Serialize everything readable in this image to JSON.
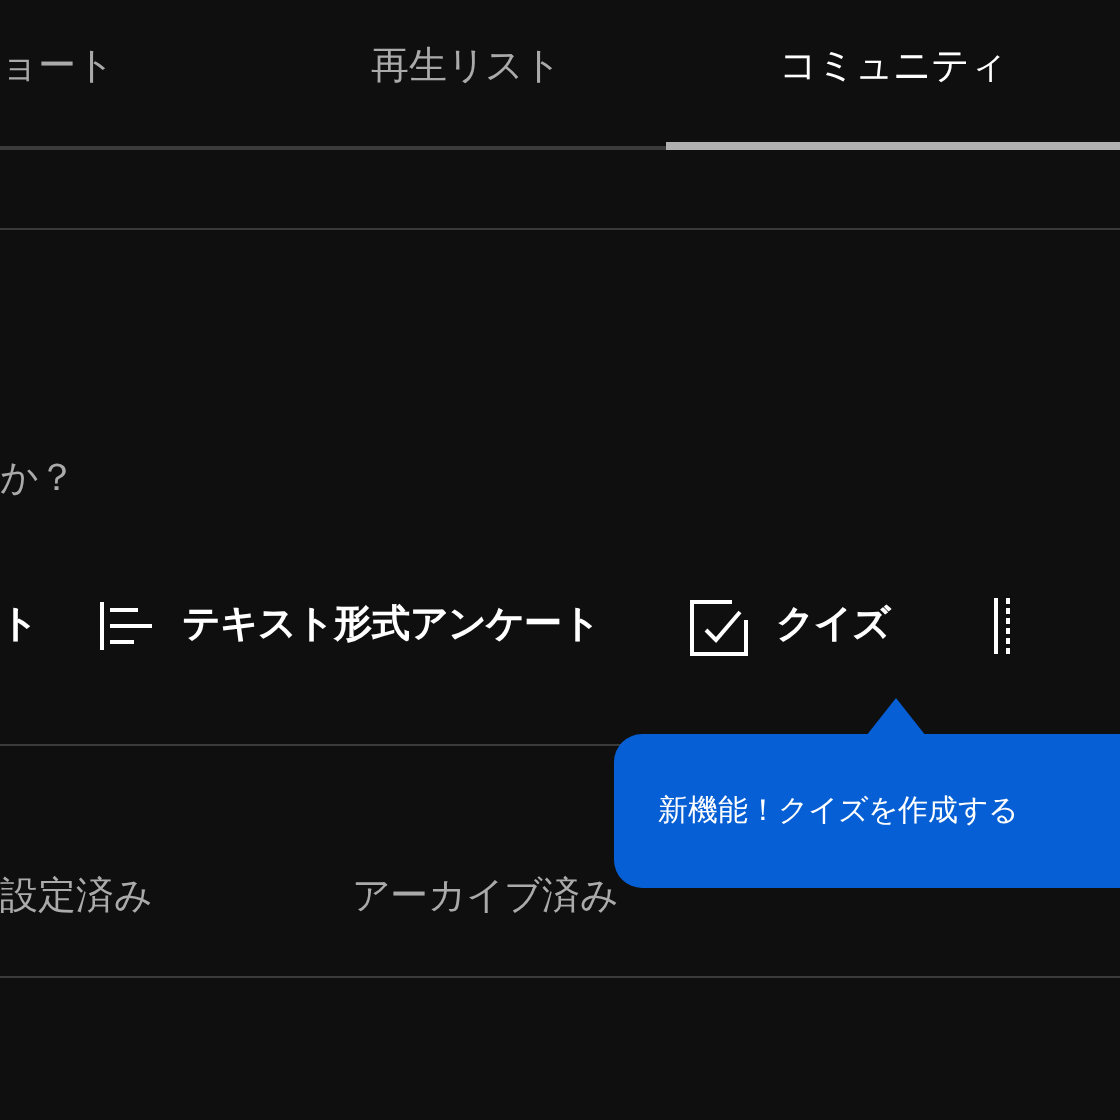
{
  "tabs": [
    {
      "label": "ョート",
      "selected": false
    },
    {
      "label": "再生リスト",
      "selected": false
    },
    {
      "label": "コミュニティ",
      "selected": true
    }
  ],
  "prompt": {
    "text": "か？"
  },
  "post_types": [
    {
      "label": "ト",
      "kind": "cut"
    },
    {
      "label": "テキスト形式アンケート",
      "kind": "text_poll"
    },
    {
      "label": "クイズ",
      "kind": "quiz"
    },
    {
      "kind": "more"
    }
  ],
  "tooltip": {
    "text": "新機能！クイズを作成する"
  },
  "filters": [
    {
      "label": "設定済み",
      "selected": false
    },
    {
      "label": "アーカイブ済み",
      "selected": false
    }
  ]
}
